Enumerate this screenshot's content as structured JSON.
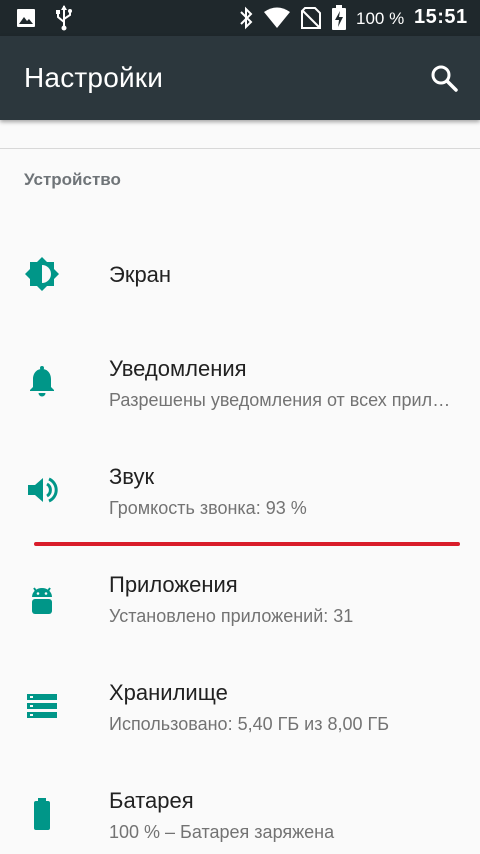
{
  "status_bar": {
    "battery_percent": "100 %",
    "time": "15:51",
    "icons": [
      "image-icon",
      "usb-icon",
      "bluetooth-icon",
      "wifi-icon",
      "no-sim-icon",
      "battery-charging-icon"
    ]
  },
  "toolbar": {
    "title": "Настройки",
    "search_icon": "search-icon"
  },
  "section": {
    "header": "Устройство"
  },
  "items": [
    {
      "title": "Экран",
      "summary": "",
      "icon": "brightness-icon"
    },
    {
      "title": "Уведомления",
      "summary": "Разрешены уведомления от всех приложений",
      "icon": "bell-icon"
    },
    {
      "title": "Звук",
      "summary": "Громкость звонка: 93 %",
      "icon": "volume-icon"
    },
    {
      "title": "Приложения",
      "summary": "Установлено приложений: 31",
      "icon": "android-icon"
    },
    {
      "title": "Хранилище",
      "summary": "Использовано: 5,40 ГБ из 8,00 ГБ",
      "icon": "storage-icon"
    },
    {
      "title": "Батарея",
      "summary": "100 % – Батарея заряжена",
      "icon": "battery-icon"
    }
  ],
  "colors": {
    "accent": "#009688",
    "toolbar": "#2c373d",
    "status_bar": "#1f282c",
    "highlight_line": "#d91c2a"
  }
}
